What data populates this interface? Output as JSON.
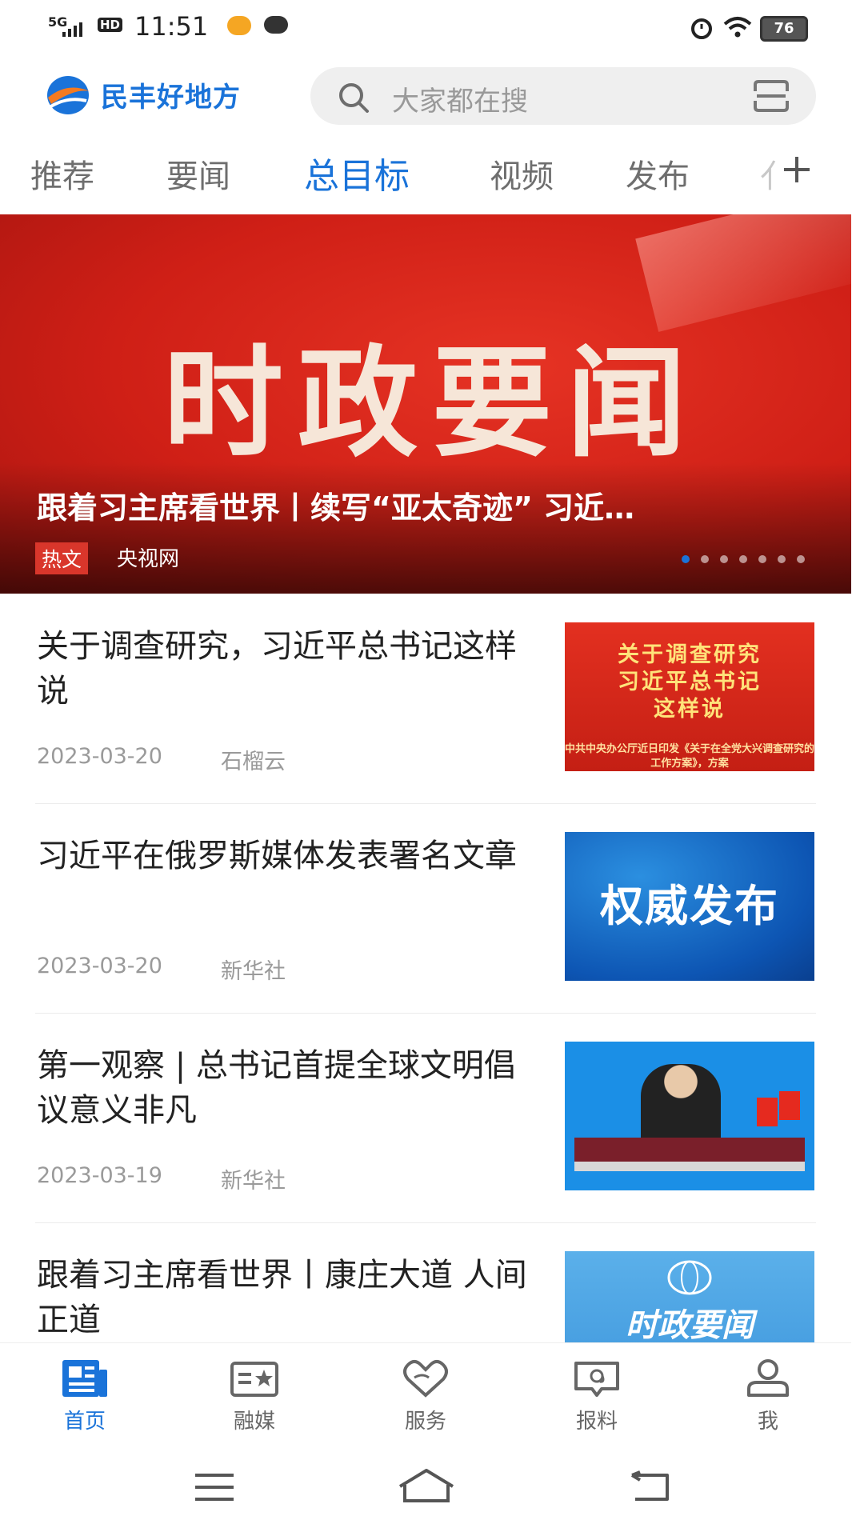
{
  "status_bar": {
    "network": "5G",
    "hd": "HD",
    "time": "11:51",
    "battery": "76"
  },
  "header": {
    "app_name": "民丰好地方",
    "search_placeholder": "大家都在搜"
  },
  "tabs": [
    {
      "label": "推荐",
      "active": false
    },
    {
      "label": "要闻",
      "active": false
    },
    {
      "label": "总目标",
      "active": true
    },
    {
      "label": "视频",
      "active": false
    },
    {
      "label": "发布",
      "active": false
    },
    {
      "label": "亻",
      "active": false
    }
  ],
  "banner": {
    "image_text": "时政要闻",
    "title": "跟着习主席看世界丨续写“亚太奇迹” 习近…",
    "tag": "热文",
    "source": "央视网",
    "dot_count": 7,
    "active_dot": 0
  },
  "articles": [
    {
      "title": "关于调查研究，习近平总书记这样说",
      "date": "2023-03-20",
      "source": "石榴云",
      "thumb_lines": [
        "关于调查研究",
        "习近平总书记",
        "这样说"
      ],
      "thumb_small": "中共中央办公厅近日印发《关于在全党大兴调查研究的工作方案》，方案"
    },
    {
      "title": "习近平在俄罗斯媒体发表署名文章",
      "date": "2023-03-20",
      "source": "新华社",
      "thumb_text": "权威发布"
    },
    {
      "title": "第一观察 | 总书记首提全球文明倡议意义非凡",
      "date": "2023-03-19",
      "source": "新华社",
      "thumb_text": ""
    },
    {
      "title": "跟着习主席看世界丨康庄大道 人间正道",
      "date": "",
      "source": "",
      "thumb_text": "时政要闻"
    }
  ],
  "bottom_nav": [
    {
      "label": "首页",
      "icon": "news-icon",
      "active": true
    },
    {
      "label": "融媒",
      "icon": "media-card-icon",
      "active": false
    },
    {
      "label": "服务",
      "icon": "heart-hands-icon",
      "active": false
    },
    {
      "label": "报料",
      "icon": "report-chat-icon",
      "active": false
    },
    {
      "label": "我",
      "icon": "user-icon",
      "active": false
    }
  ],
  "colors": {
    "accent": "#1a73d9",
    "banner_red": "#cf1f16",
    "tag_red": "#d9362b"
  }
}
